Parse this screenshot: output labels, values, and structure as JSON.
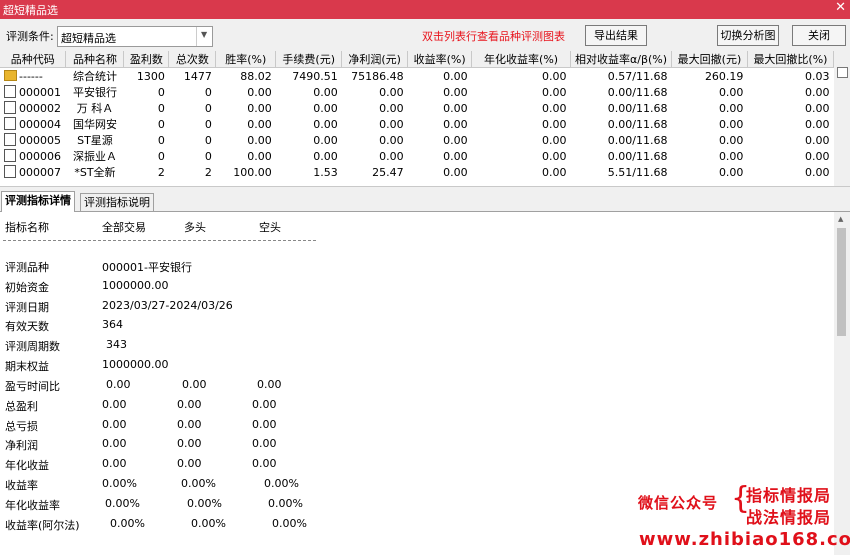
{
  "window": {
    "title": "超短精品选",
    "close_glyph": "✕"
  },
  "toolbar": {
    "condition_label": "评测条件:",
    "condition_value": "超短精品选",
    "hint": "双击列表行查看品种评测图表",
    "export_button": "导出结果",
    "switch_button": "切换分析图",
    "close_button": "关闭"
  },
  "grid": {
    "columns": [
      "品种代码",
      "品种名称",
      "盈利数",
      "总次数",
      "胜率(%)",
      "手续费(元)",
      "净利润(元)",
      "收益率(%)",
      "年化收益率(%)",
      "相对收益率α/β(%)",
      "最大回撤(元)",
      "最大回撤比(%)"
    ],
    "rows": [
      [
        "------",
        "综合统计",
        "1300",
        "1477",
        "88.02",
        "7490.51",
        "75186.48",
        "0.00",
        "0.00",
        "0.57/11.68",
        "260.19",
        "0.03"
      ],
      [
        "000001",
        "平安银行",
        "0",
        "0",
        "0.00",
        "0.00",
        "0.00",
        "0.00",
        "0.00",
        "0.00/11.68",
        "0.00",
        "0.00"
      ],
      [
        "000002",
        "万 科Ａ",
        "0",
        "0",
        "0.00",
        "0.00",
        "0.00",
        "0.00",
        "0.00",
        "0.00/11.68",
        "0.00",
        "0.00"
      ],
      [
        "000004",
        "国华网安",
        "0",
        "0",
        "0.00",
        "0.00",
        "0.00",
        "0.00",
        "0.00",
        "0.00/11.68",
        "0.00",
        "0.00"
      ],
      [
        "000005",
        "ST星源",
        "0",
        "0",
        "0.00",
        "0.00",
        "0.00",
        "0.00",
        "0.00",
        "0.00/11.68",
        "0.00",
        "0.00"
      ],
      [
        "000006",
        "深振业Ａ",
        "0",
        "0",
        "0.00",
        "0.00",
        "0.00",
        "0.00",
        "0.00",
        "0.00/11.68",
        "0.00",
        "0.00"
      ],
      [
        "000007",
        "*ST全新",
        "2",
        "2",
        "100.00",
        "1.53",
        "25.47",
        "0.00",
        "0.00",
        "5.51/11.68",
        "0.00",
        "0.00"
      ]
    ]
  },
  "tabs": {
    "detail": "评测指标详情",
    "explain": "评测指标说明"
  },
  "detail": {
    "header": {
      "name": "指标名称",
      "all": "全部交易",
      "long": "多头",
      "short": "空头"
    },
    "info": [
      {
        "label": "评测品种",
        "value": "000001-平安银行"
      },
      {
        "label": "初始资金",
        "value": "1000000.00"
      },
      {
        "label": "评测日期",
        "value": "2023/03/27-2024/03/26"
      },
      {
        "label": "有效天数",
        "value": "364"
      },
      {
        "label": "评测周期数",
        "value": "343"
      },
      {
        "label": "期末权益",
        "value": "1000000.00"
      }
    ],
    "metrics": [
      {
        "label": "盈亏时间比",
        "all": "0.00",
        "long": "0.00",
        "short": "0.00"
      },
      {
        "label": "总盈利",
        "all": "0.00",
        "long": "0.00",
        "short": "0.00"
      },
      {
        "label": "总亏损",
        "all": "0.00",
        "long": "0.00",
        "short": "0.00"
      },
      {
        "label": "净利润",
        "all": "0.00",
        "long": "0.00",
        "short": "0.00"
      },
      {
        "label": "年化收益",
        "all": "0.00",
        "long": "0.00",
        "short": "0.00"
      },
      {
        "label": "收益率",
        "all": "0.00%",
        "long": "0.00%",
        "short": "0.00%"
      },
      {
        "label": "年化收益率",
        "all": "0.00%",
        "long": "0.00%",
        "short": "0.00%"
      },
      {
        "label": "收益率(阿尔法)",
        "all": "0.00%",
        "long": "0.00%",
        "short": "0.00%"
      }
    ]
  },
  "watermark": {
    "wechat": "微信公众号",
    "brace": "{",
    "line1": "指标情报局",
    "line2": "战法情报局",
    "site": "www.zhibiao168.com"
  },
  "colors": {
    "title_bar": "#d9394c",
    "hint": "#e8131c",
    "watermark": "#e0101a"
  }
}
